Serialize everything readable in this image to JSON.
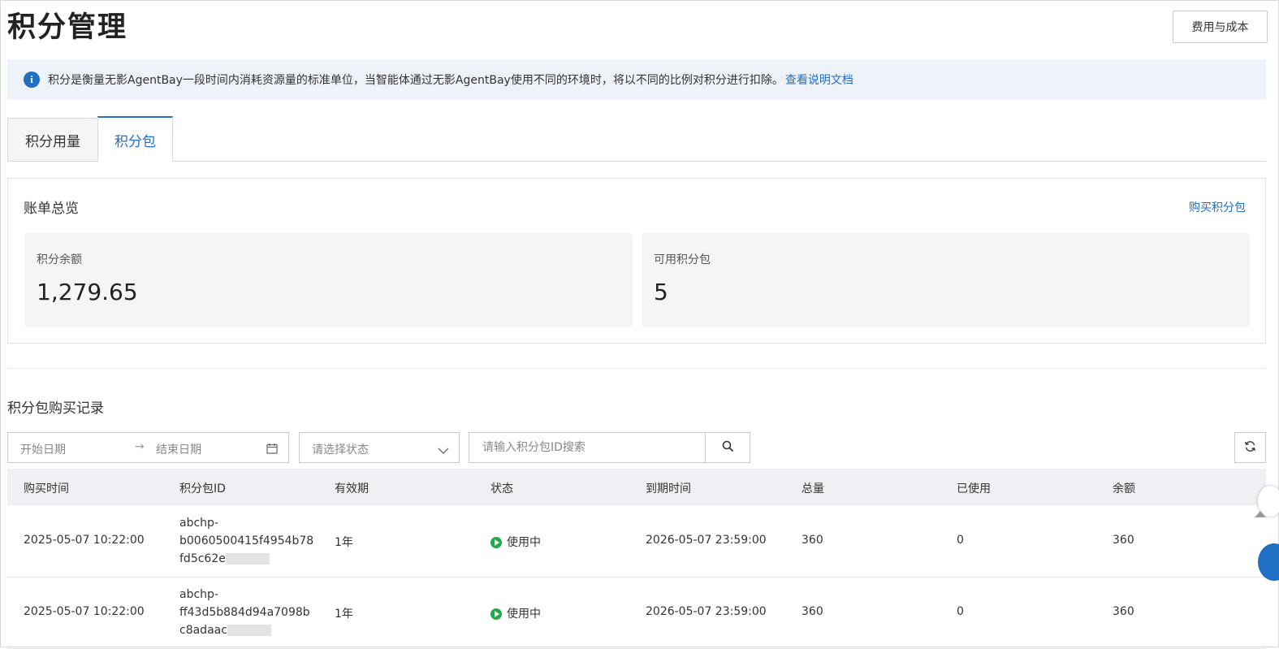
{
  "header": {
    "title": "积分管理",
    "cost_button": "费用与成本"
  },
  "notice": {
    "text": "积分是衡量无影AgentBay一段时间内消耗资源量的标准单位，当智能体通过无影AgentBay使用不同的环境时，将以不同的比例对积分进行扣除。",
    "link": "查看说明文档",
    "icon": "info-icon"
  },
  "tabs": [
    {
      "label": "积分用量"
    },
    {
      "label": "积分包"
    }
  ],
  "overview": {
    "title": "账单总览",
    "buy_link": "购买积分包",
    "balance_label": "积分余额",
    "balance_value": "1,279.65",
    "packages_label": "可用积分包",
    "packages_value": "5"
  },
  "records": {
    "title": "积分包购买记录",
    "start_date_placeholder": "开始日期",
    "end_date_placeholder": "结束日期",
    "status_placeholder": "请选择状态",
    "search_placeholder": "请输入积分包ID搜索",
    "columns": [
      "购买时间",
      "积分包ID",
      "有效期",
      "状态",
      "到期时间",
      "总量",
      "已使用",
      "余额"
    ],
    "rows": [
      {
        "purchase_time": "2025-05-07 10:22:00",
        "id_line1": "abchp-",
        "id_line2": "b0060500415f4954b78",
        "id_line3": "fd5c62e",
        "validity": "1年",
        "status": "使用中",
        "expiry": "2026-05-07 23:59:00",
        "total": "360",
        "used": "0",
        "balance": "360"
      },
      {
        "purchase_time": "2025-05-07 10:22:00",
        "id_line1": "abchp-",
        "id_line2": "ff43d5b884d94a7098b",
        "id_line3": "c8adaac",
        "validity": "1年",
        "status": "使用中",
        "expiry": "2026-05-07 23:59:00",
        "total": "360",
        "used": "0",
        "balance": "360"
      }
    ]
  },
  "colors": {
    "accent": "#1f6fc5",
    "status_active": "#23a84a",
    "notice_bg": "#eef3fa",
    "table_header_bg": "#eef0f4"
  }
}
